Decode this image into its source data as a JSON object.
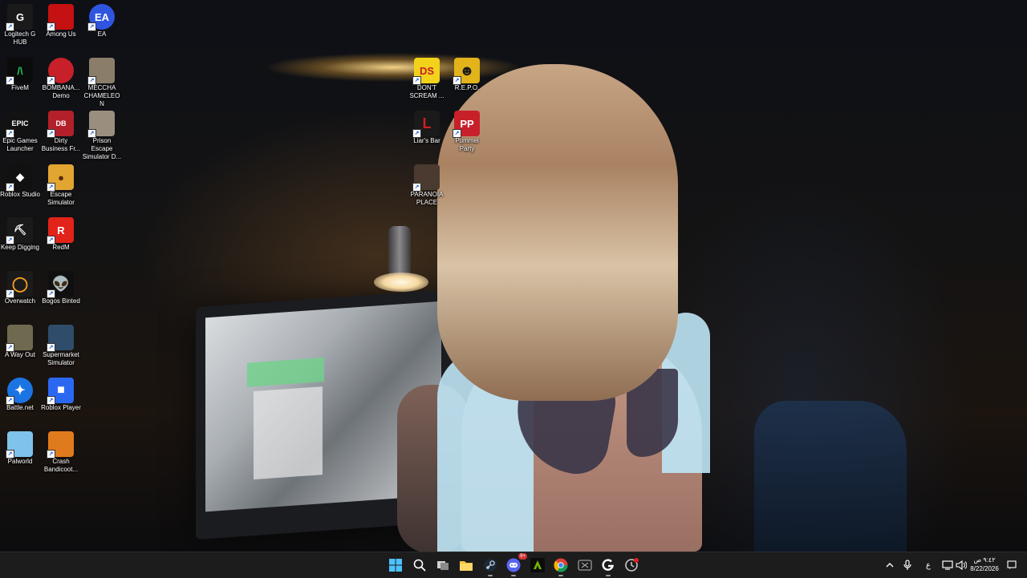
{
  "desktop": {
    "icons": [
      {
        "label": "Logitech G HUB",
        "icon": "logitech-icon",
        "glyph": "G",
        "color": "#1a1a1a"
      },
      {
        "label": "Among Us",
        "icon": "among-us-icon",
        "glyph": "",
        "color": "#c51111"
      },
      {
        "label": "EA",
        "icon": "ea-icon",
        "glyph": "EA",
        "color": "#2f55e0"
      },
      {
        "label": "FiveM",
        "icon": "fivem-icon",
        "glyph": "/\\",
        "color": "#0b0b0b"
      },
      {
        "label": "BOMBANA... Demo",
        "icon": "bombana-icon",
        "glyph": "",
        "color": "#c8202a"
      },
      {
        "label": "MECCHA CHAMELEON",
        "icon": "meccha-chameleon-icon",
        "glyph": "",
        "color": "#8a7d6a"
      },
      {
        "label": "Epic Games Launcher",
        "icon": "epic-games-icon",
        "glyph": "EPIC",
        "color": "#121212"
      },
      {
        "label": "Dirty Business Fr...",
        "icon": "dirty-business-icon",
        "glyph": "DB",
        "color": "#b3202a"
      },
      {
        "label": "Prison Escape Simulator D...",
        "icon": "prison-escape-icon",
        "glyph": "",
        "color": "#9a8f7f"
      },
      {
        "label": "Roblox Studio",
        "icon": "roblox-studio-icon",
        "glyph": "◆",
        "color": "#111111"
      },
      {
        "label": "Escape Simulator",
        "icon": "escape-simulator-icon",
        "glyph": "●",
        "color": "#e2a532"
      },
      {
        "label": "Keep Digging",
        "icon": "keep-digging-icon",
        "glyph": "⛏",
        "color": "#1a1a1a"
      },
      {
        "label": "RedM",
        "icon": "redm-icon",
        "glyph": "R",
        "color": "#e2231a"
      },
      {
        "label": "Overwatch",
        "icon": "overwatch-icon",
        "glyph": "◯",
        "color": "#1b1b1b"
      },
      {
        "label": "Bogos Binted",
        "icon": "bogos-binted-icon",
        "glyph": "👽",
        "color": "#0f0f0f"
      },
      {
        "label": "A Way Out",
        "icon": "a-way-out-icon",
        "glyph": "",
        "color": "#6f6a4f"
      },
      {
        "label": "Supermarket Simulator",
        "icon": "supermarket-simulator-icon",
        "glyph": "",
        "color": "#2f4d6a"
      },
      {
        "label": "Battle.net",
        "icon": "battle-net-icon",
        "glyph": "✦",
        "color": "#1b74e4"
      },
      {
        "label": "Roblox Player",
        "icon": "roblox-player-icon",
        "glyph": "■",
        "color": "#2b68f2"
      },
      {
        "label": "Palworld",
        "icon": "palworld-icon",
        "glyph": "",
        "color": "#7fc3ea"
      },
      {
        "label": "Crash Bandicoot...",
        "icon": "crash-bandicoot-icon",
        "glyph": "",
        "color": "#e07b1d"
      },
      {
        "label": "DON'T SCREAM ...",
        "icon": "dont-scream-icon",
        "glyph": "DS",
        "color": "#f2d21b"
      },
      {
        "label": "R.E.P.O.",
        "icon": "repo-icon",
        "glyph": "☻",
        "color": "#e2b31a"
      },
      {
        "label": "Liar's Bar",
        "icon": "liars-bar-icon",
        "glyph": "L",
        "color": "#1a1a1a"
      },
      {
        "label": "Pummel Party",
        "icon": "pummel-party-icon",
        "glyph": "PP",
        "color": "#c8202a"
      },
      {
        "label": "PARANOIA PLACE",
        "icon": "paranoia-place-icon",
        "glyph": "",
        "color": "#4a3a30"
      }
    ]
  },
  "taskbar": {
    "apps": [
      {
        "name": "start",
        "icon": "windows-start-icon"
      },
      {
        "name": "search",
        "icon": "search-icon"
      },
      {
        "name": "task-view",
        "icon": "task-view-icon"
      },
      {
        "name": "file-explorer",
        "icon": "folder-icon"
      },
      {
        "name": "steam",
        "icon": "steam-icon"
      },
      {
        "name": "discord",
        "icon": "discord-icon",
        "badge": "9+"
      },
      {
        "name": "nvidia",
        "icon": "nvidia-icon"
      },
      {
        "name": "chrome",
        "icon": "chrome-icon"
      },
      {
        "name": "xbox",
        "icon": "xbox-icon"
      },
      {
        "name": "logitech",
        "icon": "logitech-icon"
      },
      {
        "name": "app-updater",
        "icon": "app-updater-icon"
      }
    ],
    "tray": {
      "lang": "ع",
      "time": "٩:٤٢ ص",
      "date": "8/22/2026"
    }
  }
}
